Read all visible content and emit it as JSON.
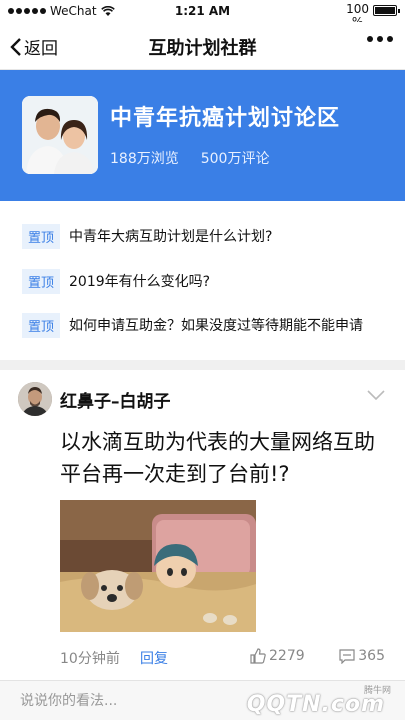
{
  "status_bar": {
    "carrier": "WeChat",
    "time": "1:21 AM",
    "battery": "100",
    "battery_unit": "%",
    "battery_level": 1.0
  },
  "nav": {
    "back_label": "返回",
    "title": "互助计划社群",
    "more_icon": "more-dots-icon"
  },
  "group": {
    "name": "中青年抗癌计划讨论区",
    "views": "188万浏览",
    "comments": "500万评论",
    "brand_color": "#3a7fe6"
  },
  "pinned": {
    "tag": "置顶",
    "items": [
      {
        "text": "中青年大病互助计划是什么计划?"
      },
      {
        "text": "2019年有什么变化吗?"
      },
      {
        "text": "如何申请互助金？如果没度过等待期能不能申请"
      }
    ]
  },
  "post": {
    "author": "红鼻子–白胡子",
    "content": "以水滴互助为代表的大量网络互助平台再一次走到了台前!?",
    "time": "10分钟前",
    "reply_label": "回复",
    "likes": "2279",
    "comments": "365"
  },
  "comment_bar": {
    "placeholder": "说说你的看法..."
  },
  "watermark": {
    "brand": "腾牛网",
    "logo": "QQTN.com"
  }
}
